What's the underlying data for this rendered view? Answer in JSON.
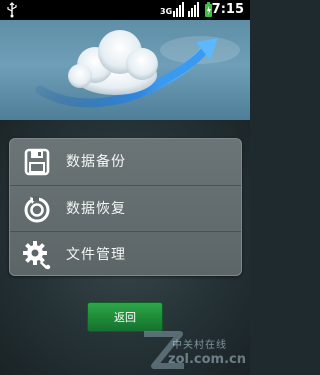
{
  "status_bar": {
    "network_label": "3G",
    "time": "7:15"
  },
  "menu": {
    "items": [
      {
        "label": "数据备份",
        "icon": "save-disk-icon"
      },
      {
        "label": "数据恢复",
        "icon": "restore-icon"
      },
      {
        "label": "文件管理",
        "icon": "settings-gear-icon"
      }
    ]
  },
  "back_button": {
    "label": "返回"
  },
  "watermark": {
    "cn": "中关村在线",
    "en": "zol.com.cn"
  },
  "colors": {
    "accent_green": "#1e8a37",
    "menu_bg": "#5c6567",
    "hero_sky": "#6f9fb8"
  }
}
